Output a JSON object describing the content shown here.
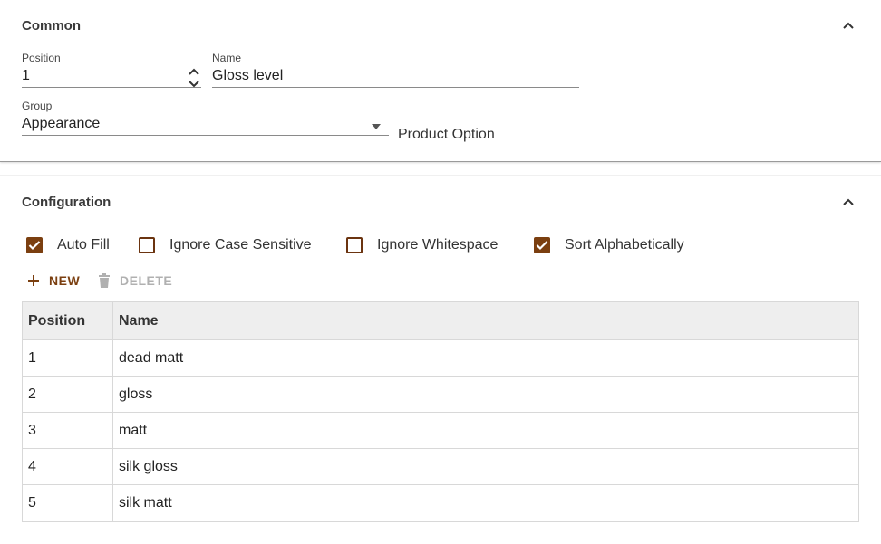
{
  "common": {
    "title": "Common",
    "position": {
      "label": "Position",
      "value": "1"
    },
    "name": {
      "label": "Name",
      "value": "Gloss level"
    },
    "group": {
      "label": "Group",
      "value": "Appearance"
    },
    "product_option_label": "Product Option"
  },
  "configuration": {
    "title": "Configuration",
    "checkboxes": [
      {
        "label": "Auto Fill",
        "checked": true
      },
      {
        "label": "Ignore Case Sensitive",
        "checked": false
      },
      {
        "label": "Ignore Whitespace",
        "checked": false
      },
      {
        "label": "Sort Alphabetically",
        "checked": true
      }
    ],
    "toolbar": {
      "new_label": "NEW",
      "delete_label": "DELETE"
    },
    "table": {
      "columns": [
        "Position",
        "Name"
      ],
      "rows": [
        {
          "position": "1",
          "name": "dead matt"
        },
        {
          "position": "2",
          "name": "gloss"
        },
        {
          "position": "3",
          "name": "matt"
        },
        {
          "position": "4",
          "name": "silk gloss"
        },
        {
          "position": "5",
          "name": "silk matt"
        }
      ]
    }
  },
  "colors": {
    "accent": "#7b3f10",
    "disabled": "#b0b0b0",
    "header_bg": "#eeeeee",
    "border": "#d8d8d8"
  },
  "icons": {
    "collapse": "chevron-up-icon",
    "stepper_up": "chevron-up-icon",
    "stepper_down": "chevron-down-icon",
    "select": "caret-down-icon",
    "check": "check-icon",
    "new": "plus-icon",
    "delete": "trash-icon"
  }
}
